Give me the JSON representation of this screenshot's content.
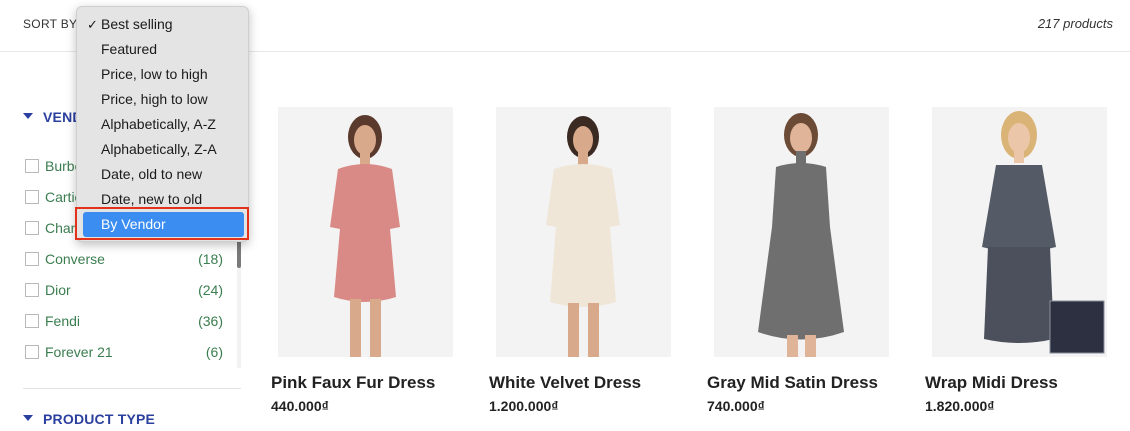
{
  "header": {
    "sort_label": "SORT BY",
    "product_count": "217 products"
  },
  "sort_dropdown": {
    "options": [
      "Best selling",
      "Featured",
      "Price, low to high",
      "Price, high to low",
      "Alphabetically, A-Z",
      "Alphabetically, Z-A",
      "Date, old to new",
      "Date, new to old",
      "By Vendor"
    ],
    "checked": "Best selling",
    "highlighted": "By Vendor",
    "check_glyph": "✓"
  },
  "sidebar": {
    "vendor_heading": "VENDOR",
    "vendors": [
      {
        "name": "Burberry",
        "count": ""
      },
      {
        "name": "Cartier",
        "count": ""
      },
      {
        "name": "Chanel",
        "count": ""
      },
      {
        "name": "Converse",
        "count": "(18)"
      },
      {
        "name": "Dior",
        "count": "(24)"
      },
      {
        "name": "Fendi",
        "count": "(36)"
      },
      {
        "name": "Forever 21",
        "count": "(6)"
      }
    ],
    "product_type_heading": "PRODUCT TYPE"
  },
  "products": [
    {
      "title": "Pink Faux Fur Dress",
      "price": "440.000₫",
      "dress_color": "#d98a86"
    },
    {
      "title": "White Velvet Dress",
      "price": "1.200.000₫",
      "dress_color": "#efe6d8"
    },
    {
      "title": "Gray Mid Satin Dress",
      "price": "740.000₫",
      "dress_color": "#6f6f6f"
    },
    {
      "title": "Wrap Midi Dress",
      "price": "1.820.000₫",
      "dress_color": "#545a66"
    }
  ],
  "colors": {
    "accent_blue": "#2b3f9e",
    "vendor_green": "#3a7d4f",
    "highlight_blue": "#3b8df2",
    "annotation_red": "#e2331a"
  }
}
